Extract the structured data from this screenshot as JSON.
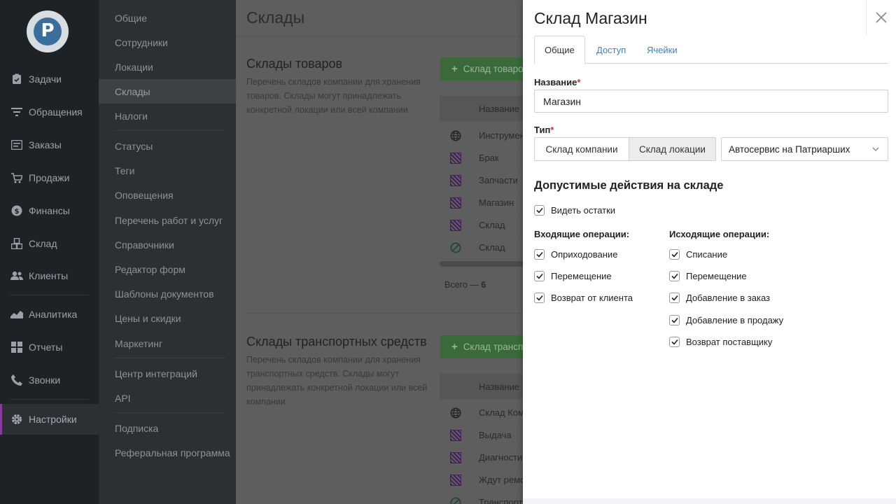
{
  "nav": {
    "logo_glyph": "P",
    "items": [
      {
        "label": "Задачи",
        "icon": "clipboard-icon"
      },
      {
        "label": "Обращения",
        "icon": "filter-icon"
      },
      {
        "label": "Заказы",
        "icon": "order-icon"
      },
      {
        "label": "Продажи",
        "icon": "cart-icon"
      },
      {
        "label": "Финансы",
        "icon": "money-icon"
      },
      {
        "label": "Склад",
        "icon": "boxes-icon"
      },
      {
        "label": "Клиенты",
        "icon": "users-icon"
      },
      {
        "label": "Аналитика",
        "icon": "chart-icon"
      },
      {
        "label": "Отчеты",
        "icon": "grid-icon"
      },
      {
        "label": "Звонки",
        "icon": "phone-icon"
      },
      {
        "label": "Настройки",
        "icon": "gear-icon"
      }
    ]
  },
  "menu": {
    "items": [
      "Общие",
      "Сотрудники",
      "Локации",
      "Склады",
      "Налоги",
      "Статусы",
      "Теги",
      "Оповещения",
      "Перечень работ и услуг",
      "Справочники",
      "Редактор форм",
      "Шаблоны документов",
      "Цены и скидки",
      "Маркетинг",
      "Центр интеграций",
      "API",
      "Подписка",
      "Реферальная программа"
    ]
  },
  "main": {
    "title": "Склады",
    "goods": {
      "title": "Склады товаров",
      "description": "Перечень складов компании для хранения товаров. Склады могут принадлежать конкретной локации или всей компании",
      "add_button": "Склад товаров",
      "col_name": "Название",
      "rows": [
        {
          "name": "Инструменты",
          "icon": "globe-icon"
        },
        {
          "name": "Брак",
          "icon": "hatched-square-icon"
        },
        {
          "name": "Запчасти",
          "icon": "hatched-square-icon"
        },
        {
          "name": "Магазин",
          "icon": "hatched-square-icon"
        },
        {
          "name": "Склад",
          "icon": "hatched-square-icon"
        },
        {
          "name": "Склад",
          "icon": "no-entry-icon"
        }
      ],
      "total_label": "Всего —",
      "total_value": "6"
    },
    "vehicles": {
      "title": "Склады транспортных средств",
      "description": "Перечень складов компании для хранения транспортных средств. Склады могут принадлежать конкретной локации или всей компании",
      "add_button": "Склад транспортных средств",
      "col_name": "Название",
      "rows": [
        {
          "name": "Склад Компании",
          "icon": "globe-icon"
        },
        {
          "name": "Выдача",
          "icon": "hatched-square-icon"
        },
        {
          "name": "Диагностика",
          "icon": "hatched-square-icon"
        },
        {
          "name": "Ждут ремонта",
          "icon": "hatched-square-icon"
        },
        {
          "name": "Транспорт",
          "icon": "no-entry-icon"
        }
      ]
    }
  },
  "drawer": {
    "title": "Склад Магазин",
    "tabs": [
      "Общие",
      "Доступ",
      "Ячейки"
    ],
    "name_label": "Название",
    "required_mark": "*",
    "name_value": "Магазин",
    "type_label": "Тип",
    "type_options": [
      "Склад компании",
      "Склад локации"
    ],
    "type_selected": "Склад локации",
    "location_value": "Автосервис на Патриарших",
    "actions_title": "Допустимые действия на складе",
    "view_stock": "Видеть остатки",
    "incoming_title": "Входящие операции:",
    "incoming": [
      "Оприходование",
      "Перемещение",
      "Возврат от клиента"
    ],
    "outgoing_title": "Исходящие операции:",
    "outgoing": [
      "Списание",
      "Перемещение",
      "Добавление в заказ",
      "Добавление в продажу",
      "Возврат поставщику"
    ]
  },
  "colors": {
    "nav_bg": "#1f2224",
    "accent_active": "#8a3a9a",
    "link_blue": "#3d7fc4",
    "required_red": "#d0302b",
    "add_green": "#3a6a3a"
  }
}
